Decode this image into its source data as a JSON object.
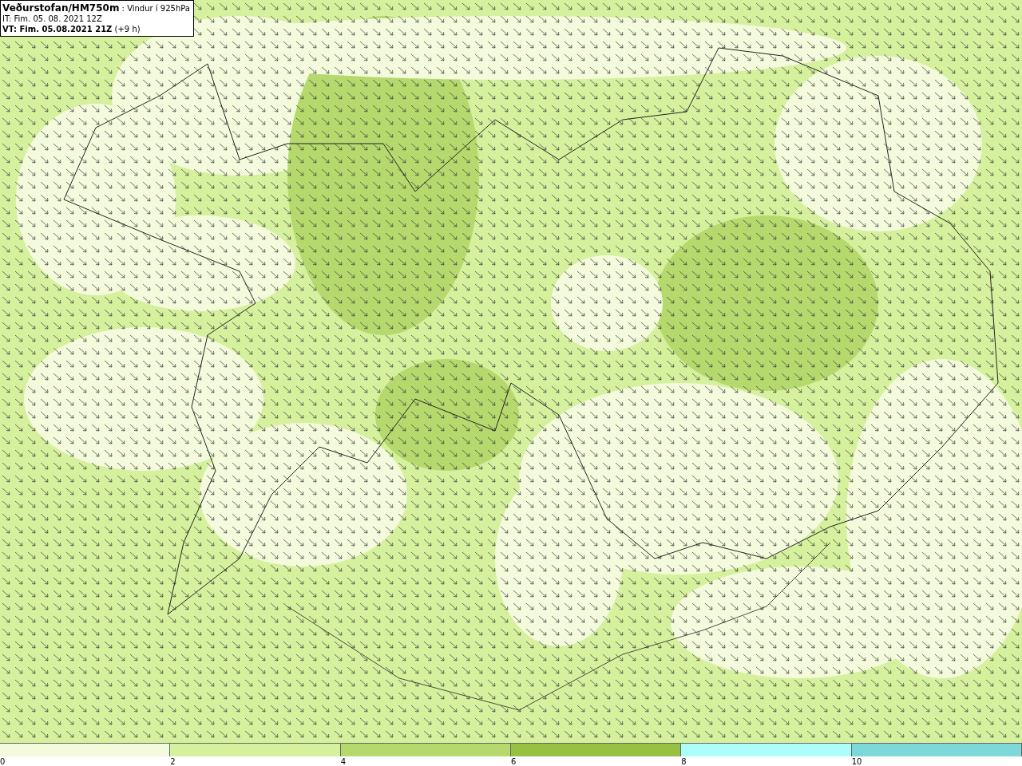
{
  "header": {
    "title": "Veðurstofan/HM750m",
    "subtitle": ": Vindur í 925hPa",
    "issue_time": "IT: Fim. 05. 08. 2021 12Z",
    "valid_time": "VT: Fim. 05.08.2021 21Z",
    "lead": "(+9 h)"
  },
  "legend": {
    "segments": [
      {
        "color": "#f4fbdc",
        "label": "0"
      },
      {
        "color": "#d6f19e",
        "label": "2"
      },
      {
        "color": "#b6d96e",
        "label": "4"
      },
      {
        "color": "#98c043",
        "label": "6"
      },
      {
        "color": "#aefdfd",
        "label": "8"
      },
      {
        "color": "#7dd8da",
        "label": "10"
      }
    ]
  }
}
